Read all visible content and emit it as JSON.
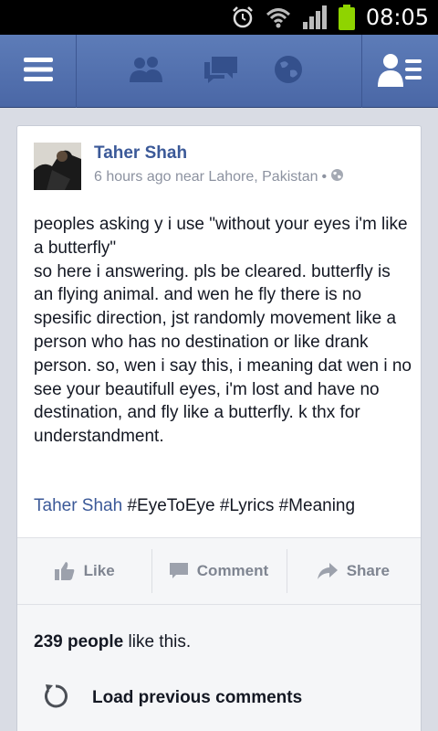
{
  "status_bar": {
    "time": "08:05",
    "icons": [
      "alarm-icon",
      "wifi-icon",
      "signal-icon",
      "battery-icon"
    ],
    "battery_color": "#8fd400"
  },
  "navbar": {
    "color": "#4e6cab",
    "icons": [
      "menu-icon",
      "friends-icon",
      "messages-icon",
      "globe-icon",
      "friend-requests-icon"
    ]
  },
  "post": {
    "author": "Taher Shah",
    "time": "6 hours ago near Lahore, Pakistan",
    "separator": "•",
    "privacy_icon": "globe-icon",
    "body": "peoples asking y i use \"without your eyes i'm like a butterfly\"\nso here i answering. pls be cleared. butterfly is an flying animal. and wen he fly there is no spesific direction, jst randomly movement like a person who has no destination or like drank person. so, wen i say this, i meaning dat wen i no see your beautifull eyes, i'm lost and have no destination, and fly like a butterfly. k thx for understandment.",
    "tag_name": "Taher Shah",
    "hashtags": "#EyeToEye #Lyrics #Meaning"
  },
  "actions": {
    "like": "Like",
    "comment": "Comment",
    "share": "Share"
  },
  "likes": {
    "count": "239 people",
    "suffix": " like this."
  },
  "comments": {
    "load_previous": "Load previous comments"
  }
}
